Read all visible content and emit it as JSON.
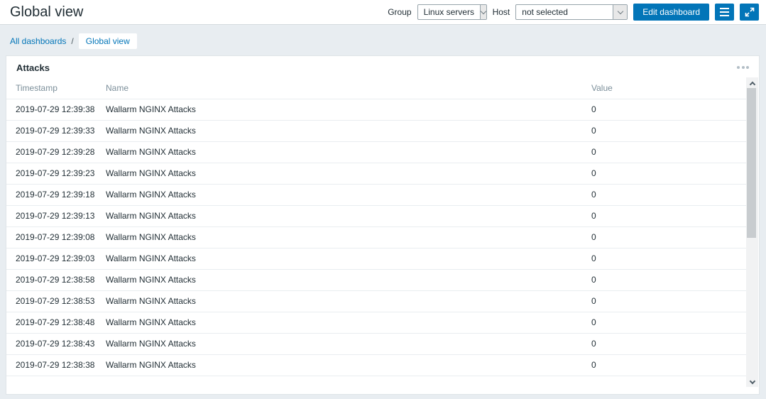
{
  "page": {
    "title": "Global view"
  },
  "header": {
    "group_label": "Group",
    "group_value": "Linux servers",
    "host_label": "Host",
    "host_value": "not selected",
    "edit_button": "Edit dashboard"
  },
  "breadcrumb": {
    "items": [
      {
        "label": "All dashboards"
      },
      {
        "label": "Global view"
      }
    ],
    "separator": "/"
  },
  "widget": {
    "title": "Attacks",
    "table": {
      "columns": [
        "Timestamp",
        "Name",
        "Value"
      ],
      "rows": [
        [
          "2019-07-29 12:39:38",
          "Wallarm NGINX Attacks",
          "0"
        ],
        [
          "2019-07-29 12:39:33",
          "Wallarm NGINX Attacks",
          "0"
        ],
        [
          "2019-07-29 12:39:28",
          "Wallarm NGINX Attacks",
          "0"
        ],
        [
          "2019-07-29 12:39:23",
          "Wallarm NGINX Attacks",
          "0"
        ],
        [
          "2019-07-29 12:39:18",
          "Wallarm NGINX Attacks",
          "0"
        ],
        [
          "2019-07-29 12:39:13",
          "Wallarm NGINX Attacks",
          "0"
        ],
        [
          "2019-07-29 12:39:08",
          "Wallarm NGINX Attacks",
          "0"
        ],
        [
          "2019-07-29 12:39:03",
          "Wallarm NGINX Attacks",
          "0"
        ],
        [
          "2019-07-29 12:38:58",
          "Wallarm NGINX Attacks",
          "0"
        ],
        [
          "2019-07-29 12:38:53",
          "Wallarm NGINX Attacks",
          "0"
        ],
        [
          "2019-07-29 12:38:48",
          "Wallarm NGINX Attacks",
          "0"
        ],
        [
          "2019-07-29 12:38:43",
          "Wallarm NGINX Attacks",
          "0"
        ],
        [
          "2019-07-29 12:38:38",
          "Wallarm NGINX Attacks",
          "0"
        ]
      ]
    }
  },
  "colors": {
    "accent_blue": "#0275b8",
    "page_background": "#e8edf1",
    "header_text_gray": "#7c8f9a"
  }
}
